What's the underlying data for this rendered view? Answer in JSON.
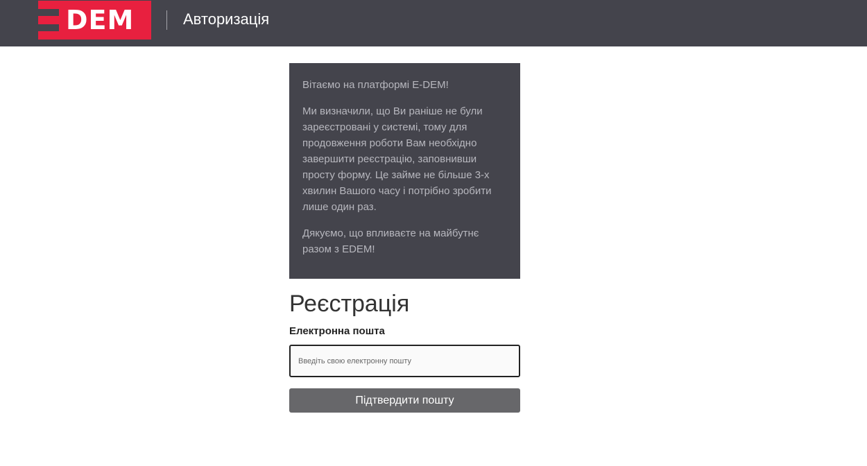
{
  "header": {
    "logo_text": "DEM",
    "title": "Авторизація"
  },
  "info": {
    "paragraphs": [
      "Вітаємо на платформі E-DEM!",
      "Ми визначили, що Ви раніше не були зареєстровані у системі, тому для продовження роботи Вам необхідно завершити реєстрацію, заповнивши просту форму. Це займе не більше 3-х хвилин Вашого часу і потрібно зробити лише один раз.",
      "Дякуємо, що впливаєте на майбутнє разом з EDEM!"
    ]
  },
  "form": {
    "title": "Реєстрація",
    "email_label": "Електронна пошта",
    "email_value": "",
    "email_placeholder": "Введіть свою електронну пошту",
    "submit_label": "Підтвердити пошту"
  },
  "colors": {
    "header_bg": "#44444c",
    "brand_red": "#e8203f",
    "button_bg": "#67676a"
  }
}
